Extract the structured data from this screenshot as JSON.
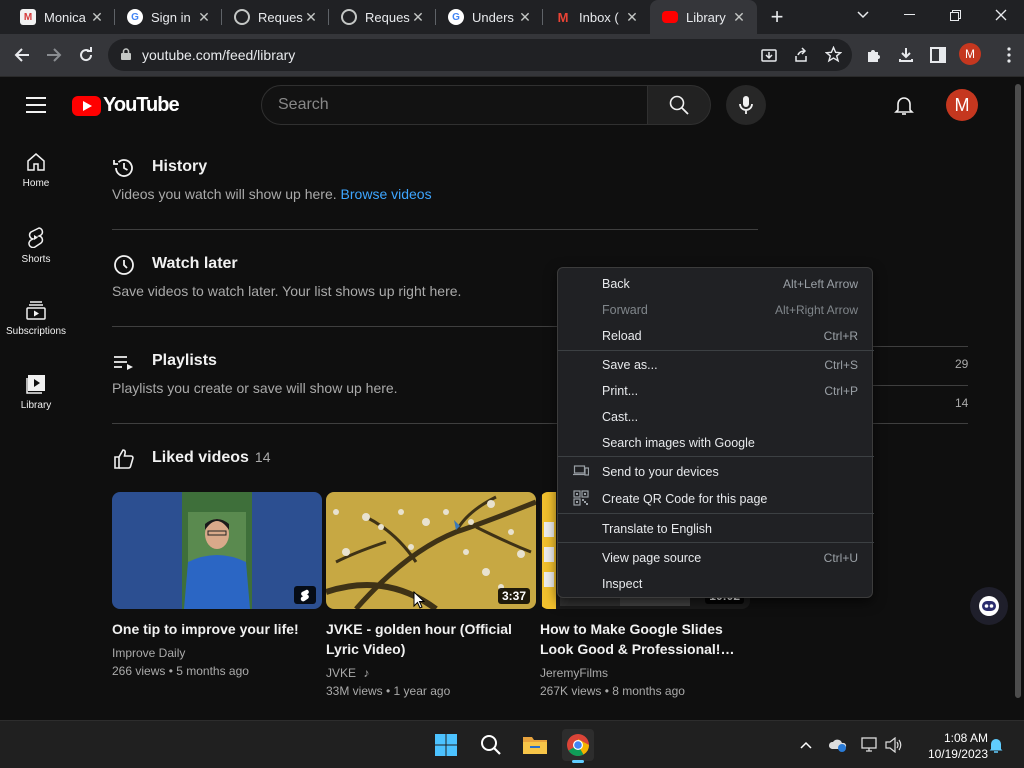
{
  "browser": {
    "tabs": [
      {
        "label": "Monica",
        "favicon": "monica-icon"
      },
      {
        "label": "Sign in",
        "favicon": "google-icon"
      },
      {
        "label": "Reques",
        "favicon": "globe-icon"
      },
      {
        "label": "Reques",
        "favicon": "globe-icon"
      },
      {
        "label": "Unders",
        "favicon": "google-icon"
      },
      {
        "label": "Inbox (",
        "favicon": "gmail-icon"
      },
      {
        "label": "Library",
        "favicon": "youtube-icon",
        "active": true
      }
    ],
    "url": "youtube.com/feed/library",
    "profile_initial": "M"
  },
  "youtube": {
    "logo_text": "YouTube",
    "search_placeholder": "Search",
    "avatar_initial": "M",
    "guide": [
      {
        "label": "Home",
        "icon": "home-icon"
      },
      {
        "label": "Shorts",
        "icon": "shorts-icon"
      },
      {
        "label": "Subscriptions",
        "icon": "subscriptions-icon"
      },
      {
        "label": "Library",
        "icon": "library-icon"
      }
    ],
    "sections": {
      "history": {
        "title": "History",
        "desc": "Videos you watch will show up here.",
        "link": "Browse videos"
      },
      "watch_later": {
        "title": "Watch later",
        "desc": "Save videos to watch later. Your list shows up right here."
      },
      "playlists": {
        "title": "Playlists",
        "desc": "Playlists you create or save will show up here."
      },
      "liked": {
        "title": "Liked videos",
        "count": "14"
      }
    },
    "right_stats": [
      "29",
      "14"
    ],
    "videos": [
      {
        "title": "One tip to improve your life!",
        "channel": "Improve Daily",
        "meta": "266 views • 5 months ago",
        "badge": "shorts"
      },
      {
        "title": "JVKE - golden hour (Official Lyric Video)",
        "channel": "JVKE",
        "meta": "33M views • 1 year ago",
        "duration": "3:37"
      },
      {
        "title": "How to Make Google Slides Look Good & Professional!…",
        "channel": "JeremyFilms",
        "meta": "267K views • 8 months ago",
        "duration": "10:02"
      }
    ]
  },
  "context_menu": {
    "items": [
      {
        "label": "Back",
        "shortcut": "Alt+Left Arrow"
      },
      {
        "label": "Forward",
        "shortcut": "Alt+Right Arrow",
        "disabled": true
      },
      {
        "label": "Reload",
        "shortcut": "Ctrl+R"
      },
      {
        "label": "Save as...",
        "shortcut": "Ctrl+S"
      },
      {
        "label": "Print...",
        "shortcut": "Ctrl+P"
      },
      {
        "label": "Cast...",
        "shortcut": ""
      },
      {
        "label": "Search images with Google",
        "shortcut": ""
      },
      {
        "label": "Send to your devices",
        "shortcut": "",
        "icon": "devices-icon"
      },
      {
        "label": "Create QR Code for this page",
        "shortcut": "",
        "icon": "qr-code-icon"
      },
      {
        "label": "Translate to English",
        "shortcut": ""
      },
      {
        "label": "View page source",
        "shortcut": "Ctrl+U"
      },
      {
        "label": "Inspect",
        "shortcut": ""
      }
    ]
  },
  "taskbar": {
    "time": "1:08 AM",
    "date": "10/19/2023"
  },
  "colors": {
    "youtube_red": "#ff0000",
    "link_blue": "#3ea6ff",
    "avatar": "#c5371f",
    "page_bg": "#0f0f0f"
  }
}
